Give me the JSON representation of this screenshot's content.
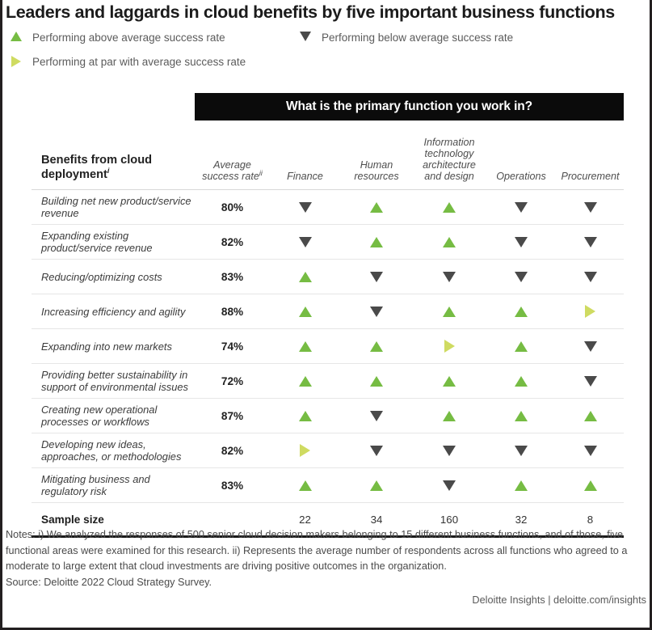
{
  "colors": {
    "above_green": "#76bc43",
    "below_dark": "#4a4a4a",
    "at_par_yellow": "#cfdb61",
    "banner_black": "#0b0b0b",
    "border_black": "#231f20"
  },
  "title": "Leaders and laggards in cloud benefits by five important business functions",
  "legend": [
    {
      "marker": "up",
      "icon": "triangle-up-icon",
      "label": "Performing above average success rate"
    },
    {
      "marker": "down",
      "icon": "triangle-down-icon",
      "label": "Performing below average success rate"
    },
    {
      "marker": "right",
      "icon": "triangle-right-icon",
      "label": "Performing at par with average success rate"
    }
  ],
  "banner_title": "What is the primary function you work in?",
  "columns": {
    "benefit": "Benefits from cloud deployment",
    "benefit_note": "i",
    "average": "Average success rate",
    "average_note": "ii",
    "finance": "Finance",
    "human_resources": "Human resources",
    "it": "Information technology architecture and design",
    "operations": "Operations",
    "procurement": "Procurement"
  },
  "sample_size_label": "Sample size",
  "chart_data": {
    "type": "table",
    "title": "Leaders and laggards in cloud benefits by five important business functions",
    "categories": [
      "Finance",
      "Human resources",
      "Information technology architecture and design",
      "Operations",
      "Procurement"
    ],
    "marker_legend": {
      "up": "Performing above average success rate",
      "down": "Performing below average success rate",
      "right": "Performing at par with average success rate"
    },
    "sample_sizes": [
      "22",
      "34",
      "160",
      "32",
      "8"
    ],
    "rows": [
      {
        "benefit": "Building net new product/service revenue",
        "average": "80%",
        "marks": [
          "down",
          "up",
          "up",
          "down",
          "down"
        ]
      },
      {
        "benefit": "Expanding existing product/service revenue",
        "average": "82%",
        "marks": [
          "down",
          "up",
          "up",
          "down",
          "down"
        ]
      },
      {
        "benefit": "Reducing/optimizing costs",
        "average": "83%",
        "marks": [
          "up",
          "down",
          "down",
          "down",
          "down"
        ]
      },
      {
        "benefit": "Increasing efficiency and agility",
        "average": "88%",
        "marks": [
          "up",
          "down",
          "up",
          "up",
          "right"
        ]
      },
      {
        "benefit": "Expanding into new markets",
        "average": "74%",
        "marks": [
          "up",
          "up",
          "right",
          "up",
          "down"
        ]
      },
      {
        "benefit": "Providing better sustainability in support of environmental issues",
        "average": "72%",
        "marks": [
          "up",
          "up",
          "up",
          "up",
          "down"
        ]
      },
      {
        "benefit": "Creating new operational processes or workflows",
        "average": "87%",
        "marks": [
          "up",
          "down",
          "up",
          "up",
          "up"
        ]
      },
      {
        "benefit": "Developing new ideas, approaches, or methodologies",
        "average": "82%",
        "marks": [
          "right",
          "down",
          "down",
          "down",
          "down"
        ]
      },
      {
        "benefit": "Mitigating business and regulatory risk",
        "average": "83%",
        "marks": [
          "up",
          "up",
          "down",
          "up",
          "up"
        ]
      }
    ]
  },
  "notes": "Notes: i) We analyzed the responses of 500 senior cloud decision makers belonging to 15 different business functions, and of those, five functional areas were examined for this research. ii) Represents the average number of respondents across all functions who agreed to a moderate to large extent that cloud investments are driving positive outcomes in the organization.",
  "source": "Source: Deloitte 2022 Cloud Strategy Survey.",
  "credit": "Deloitte Insights | deloitte.com/insights"
}
